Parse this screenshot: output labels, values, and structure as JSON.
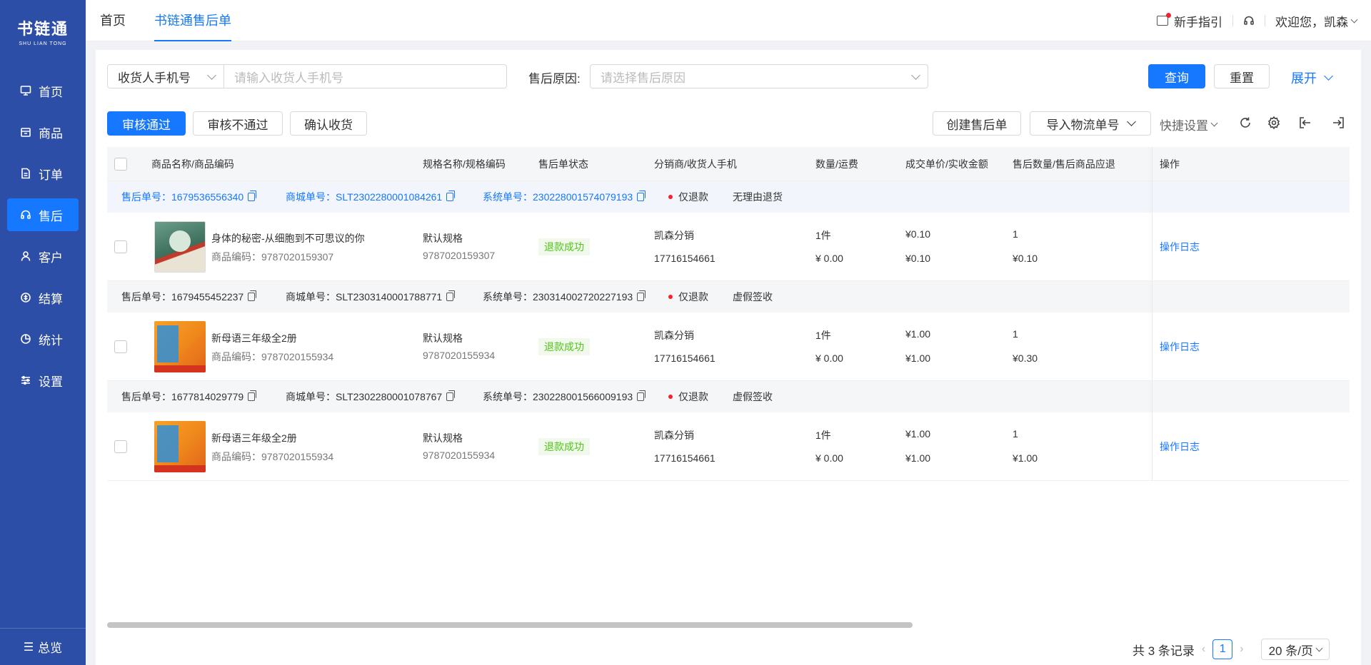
{
  "sidebar": {
    "logo": "书链通",
    "logo_sub": "SHU LIAN TONG",
    "items": [
      {
        "label": "首页",
        "icon": "monitor-icon"
      },
      {
        "label": "商品",
        "icon": "box-icon"
      },
      {
        "label": "订单",
        "icon": "document-icon"
      },
      {
        "label": "售后",
        "icon": "headset-icon",
        "active": true
      },
      {
        "label": "客户",
        "icon": "user-icon"
      },
      {
        "label": "结算",
        "icon": "settle-icon"
      },
      {
        "label": "统计",
        "icon": "pie-icon"
      },
      {
        "label": "设置",
        "icon": "sliders-icon"
      }
    ],
    "bottom": "总览"
  },
  "topbar": {
    "tabs": [
      "首页",
      "书链通售后单"
    ],
    "active_tab": 1,
    "guide": "新手指引",
    "welcome": "欢迎您，凯森"
  },
  "search": {
    "field_select": "收货人手机号",
    "phone_placeholder": "请输入收货人手机号",
    "reason_label": "售后原因:",
    "reason_placeholder": "请选择售后原因",
    "query": "查询",
    "reset": "重置",
    "expand": "展开"
  },
  "toolbar": {
    "approve": "审核通过",
    "reject": "审核不通过",
    "confirm_receipt": "确认收货",
    "create": "创建售后单",
    "import_logistics": "导入物流单号",
    "quick_settings": "快捷设置"
  },
  "table": {
    "headers": [
      "商品名称/商品编码",
      "规格名称/规格编码",
      "售后单状态",
      "分销商/收货人手机",
      "数量/运费",
      "成交单价/实收金额",
      "售后数量/售后商品应退",
      "操作"
    ],
    "orders": [
      {
        "after_sale_no": "售后单号：1679536556340",
        "mall_no": "商城单号：SLT2302280001084261",
        "system_no": "系统单号：230228001574079193",
        "type": "仅退款",
        "reason": "无理由退货",
        "product_name": "身体的秘密-从细胞到不可思议的你",
        "product_code": "商品编码：9787020159307",
        "spec_name": "默认规格",
        "spec_code": "9787020159307",
        "status": "退款成功",
        "distributor": "凯森分销",
        "phone": "17716154661",
        "qty": "1件",
        "freight": "¥ 0.00",
        "unit_price": "¥0.10",
        "received": "¥0.10",
        "after_qty": "1",
        "refund": "¥0.10",
        "op": "操作日志",
        "thumb": "green-book"
      },
      {
        "after_sale_no": "售后单号：1679455452237",
        "mall_no": "商城单号：SLT2303140001788771",
        "system_no": "系统单号：230314002720227193",
        "type": "仅退款",
        "reason": "虚假签收",
        "product_name": "新母语三年级全2册",
        "product_code": "商品编码：9787020155934",
        "spec_name": "默认规格",
        "spec_code": "9787020155934",
        "status": "退款成功",
        "distributor": "凯森分销",
        "phone": "17716154661",
        "qty": "1件",
        "freight": "¥ 0.00",
        "unit_price": "¥1.00",
        "received": "¥1.00",
        "after_qty": "1",
        "refund": "¥0.30",
        "op": "操作日志",
        "thumb": "orange-book"
      },
      {
        "after_sale_no": "售后单号：1677814029779",
        "mall_no": "商城单号：SLT2302280001078767",
        "system_no": "系统单号：230228001566009193",
        "type": "仅退款",
        "reason": "虚假签收",
        "product_name": "新母语三年级全2册",
        "product_code": "商品编码：9787020155934",
        "spec_name": "默认规格",
        "spec_code": "9787020155934",
        "status": "退款成功",
        "distributor": "凯森分销",
        "phone": "17716154661",
        "qty": "1件",
        "freight": "¥ 0.00",
        "unit_price": "¥1.00",
        "received": "¥1.00",
        "after_qty": "1",
        "refund": "¥1.00",
        "op": "操作日志",
        "thumb": "orange-book"
      }
    ]
  },
  "pagination": {
    "total": "共 3 条记录",
    "page": "1",
    "page_size": "20 条/页"
  },
  "colors": {
    "sidebar": "#2d4ea7",
    "primary": "#1677ff",
    "success": "#52c41a",
    "danger": "#f5222d"
  }
}
